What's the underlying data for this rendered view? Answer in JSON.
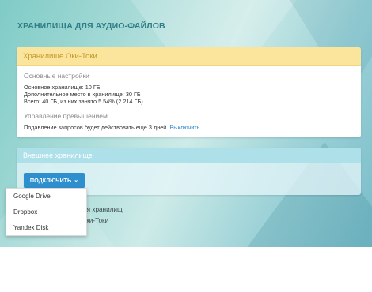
{
  "page": {
    "title": "ХРАНИЛИЩА ДЛЯ АУДИО-ФАЙЛОВ"
  },
  "oki_storage": {
    "header": "Хранилище Оки-Токи",
    "settings_title": "Основные настройки",
    "main_storage": "Основное хранилище: 10 ГБ",
    "extra_storage": "Дополнительное место в хранилище: 30 ГБ",
    "total": "Всего: 40 ГБ, из них занято 5.54% (2.214 ГБ)",
    "overflow_title": "Управление превышением",
    "suppression_text": "Подавление запросов будет действовать еще 3 дней.",
    "disable_link": "Выключить"
  },
  "external_storage": {
    "header": "Внешнее хранилище",
    "connect_button": "ПОДКЛЮЧИТЬ",
    "dropdown_options": [
      "Google Drive",
      "Dropbox",
      "Yandex Disk"
    ]
  },
  "behind_dropdown": {
    "line1": "ания хранилищ",
    "line2": "е Оки-Токи"
  },
  "colors": {
    "accent": "#2e8fcf",
    "oki_header_bg": "#fbe59d",
    "external_header_bg": "#aee0ea",
    "title": "#2f7d86"
  }
}
